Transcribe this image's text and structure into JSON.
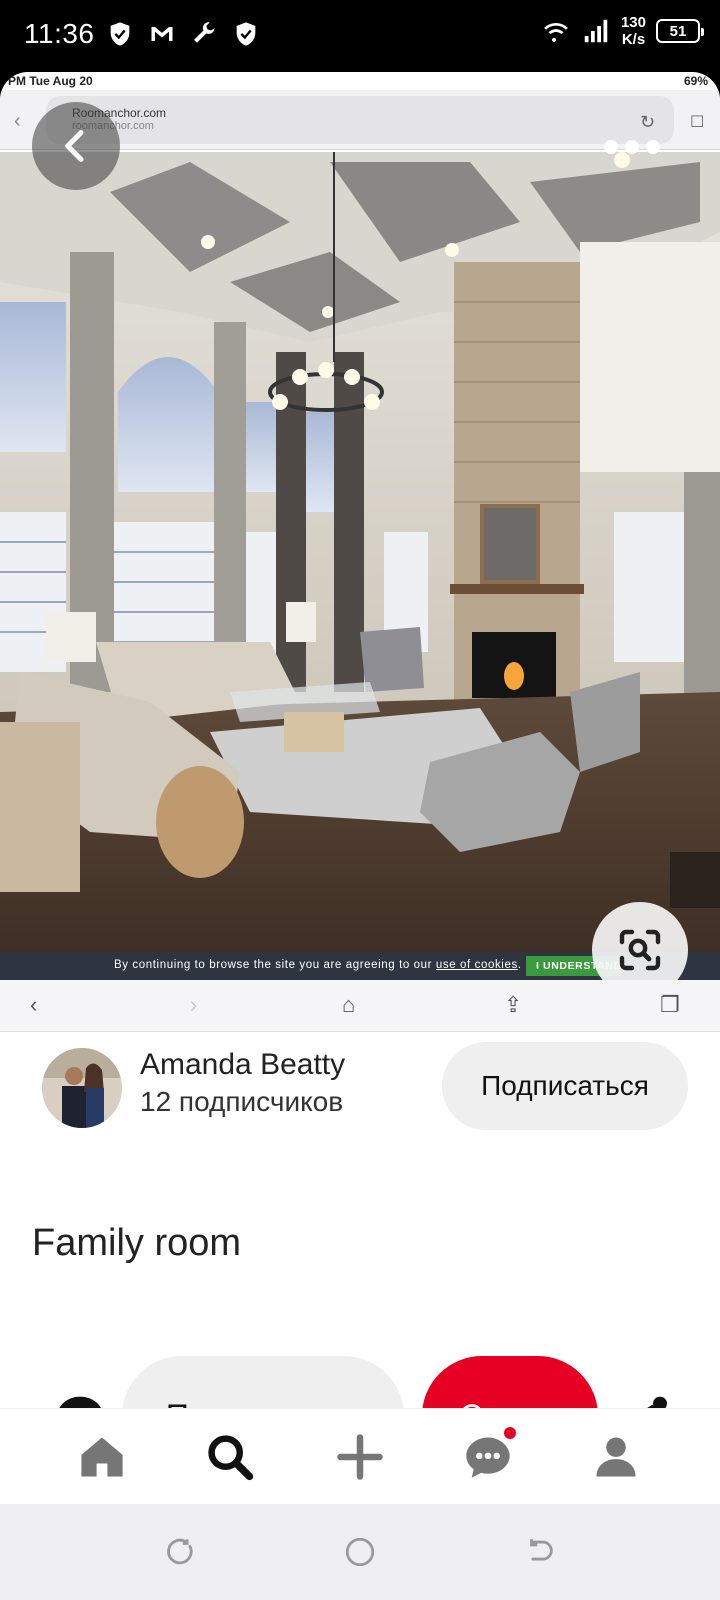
{
  "status_bar": {
    "time": "11:36",
    "net_speed_value": "130",
    "net_speed_unit": "K/s",
    "battery": "51"
  },
  "pin_image": {
    "inner_status_left": "PM   Tue Aug 20",
    "inner_status_right": "69%",
    "site_name": "Roomanchor.com",
    "site_url": "roomanchor.com",
    "cookie_text_prefix": "By continuing to browse the site you are agreeing to our ",
    "cookie_link": "use of cookies",
    "cookie_text_suffix": ".",
    "cookie_button": "I UNDERSTAND"
  },
  "creator": {
    "name": "Amanda Beatty",
    "followers": "12 подписчиков",
    "follow_label": "Подписаться"
  },
  "pin": {
    "title": "Family room"
  },
  "actions": {
    "view_label": "Просмотреть",
    "save_label": "Сохр..."
  },
  "tabs": [
    "home",
    "search",
    "create",
    "messages",
    "profile"
  ],
  "colors": {
    "accent": "#e60023",
    "button_gray": "#efefef",
    "text": "#222222"
  }
}
